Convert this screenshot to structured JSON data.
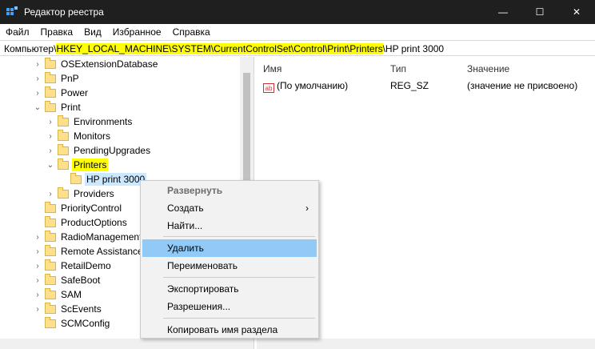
{
  "window": {
    "title": "Редактор реестра",
    "minimize_glyph": "—",
    "maximize_glyph": "☐",
    "close_glyph": "✕"
  },
  "menu": [
    "Файл",
    "Правка",
    "Вид",
    "Избранное",
    "Справка"
  ],
  "address": {
    "prefix": "Компьютер\\",
    "highlighted": "HKEY_LOCAL_MACHINE\\SYSTEM\\CurrentControlSet\\Control\\Print\\Printers",
    "suffix": "\\HP print 3000"
  },
  "tree": {
    "items": [
      {
        "label": "OSExtensionDatabase",
        "level": 1,
        "twisty": "›"
      },
      {
        "label": "PnP",
        "level": 1,
        "twisty": "›"
      },
      {
        "label": "Power",
        "level": 1,
        "twisty": "›"
      },
      {
        "label": "Print",
        "level": 1,
        "twisty": "⌄"
      },
      {
        "label": "Environments",
        "level": 2,
        "twisty": "›"
      },
      {
        "label": "Monitors",
        "level": 2,
        "twisty": "›"
      },
      {
        "label": "PendingUpgrades",
        "level": 2,
        "twisty": "›"
      },
      {
        "label": "Printers",
        "level": 2,
        "twisty": "⌄"
      },
      {
        "label": "HP print 3000",
        "level": 3,
        "twisty": ""
      },
      {
        "label": "Providers",
        "level": 2,
        "twisty": "›"
      },
      {
        "label": "PriorityControl",
        "level": 1,
        "twisty": ""
      },
      {
        "label": "ProductOptions",
        "level": 1,
        "twisty": ""
      },
      {
        "label": "RadioManagement",
        "level": 1,
        "twisty": "›"
      },
      {
        "label": "Remote Assistance",
        "level": 1,
        "twisty": "›"
      },
      {
        "label": "RetailDemo",
        "level": 1,
        "twisty": "›"
      },
      {
        "label": "SafeBoot",
        "level": 1,
        "twisty": "›"
      },
      {
        "label": "SAM",
        "level": 1,
        "twisty": "›"
      },
      {
        "label": "ScEvents",
        "level": 1,
        "twisty": "›"
      },
      {
        "label": "SCMConfig",
        "level": 1,
        "twisty": ""
      }
    ]
  },
  "list": {
    "headers": {
      "name": "Имя",
      "type": "Тип",
      "value": "Значение"
    },
    "rows": [
      {
        "icon": "ab",
        "name": "(По умолчанию)",
        "type": "REG_SZ",
        "value": "(значение не присвоено)"
      }
    ]
  },
  "context_menu": {
    "items": [
      {
        "label": "Развернуть",
        "state": "disabled"
      },
      {
        "label": "Создать",
        "submenu_arrow": "›"
      },
      {
        "label": "Найти..."
      },
      {
        "label": "Удалить",
        "state": "hover"
      },
      {
        "label": "Переименовать"
      },
      {
        "label": "Экспортировать"
      },
      {
        "label": "Разрешения..."
      },
      {
        "label": "Копировать имя раздела"
      }
    ]
  },
  "colors": {
    "highlight_yellow": "#ffff00",
    "menu_hover": "#91c9f7",
    "titlebar": "#1f1f1f"
  }
}
